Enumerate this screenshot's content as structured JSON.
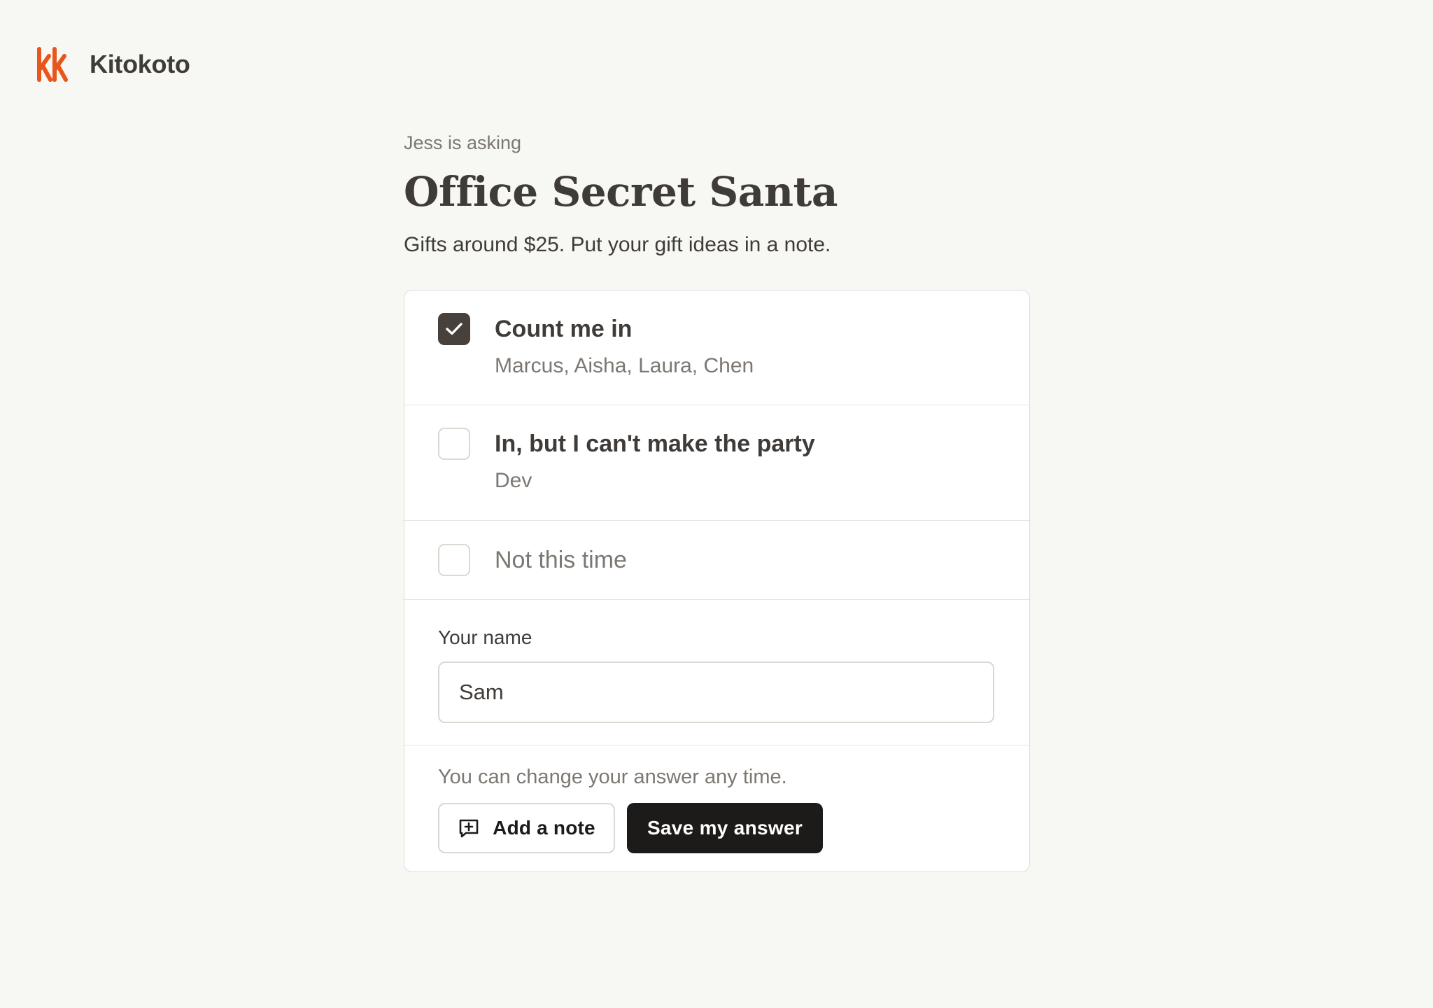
{
  "brand": {
    "name": "Kitokoto",
    "logo_icon": "kk-logo-icon",
    "accent_color": "#e9561c"
  },
  "poll": {
    "asker": "Jess is asking",
    "title": "Office Secret Santa",
    "description": "Gifts around $25. Put your gift ideas in a note."
  },
  "options": [
    {
      "label": "Count me in",
      "respondents": "Marcus, Aisha, Laura, Chen",
      "checked": true
    },
    {
      "label": "In, but I can't make the party",
      "respondents": "Dev",
      "checked": false
    },
    {
      "label": "Not this time",
      "respondents": "",
      "checked": false
    }
  ],
  "name_field": {
    "label": "Your name",
    "value": "Sam"
  },
  "footer": {
    "hint": "You can change your answer any time.",
    "add_note_label": "Add a note",
    "add_note_icon": "message-plus-icon",
    "save_label": "Save my answer"
  },
  "colors": {
    "background": "#f7f7f4",
    "checked_box": "#47403b",
    "primary_button": "#1d1b1a"
  }
}
